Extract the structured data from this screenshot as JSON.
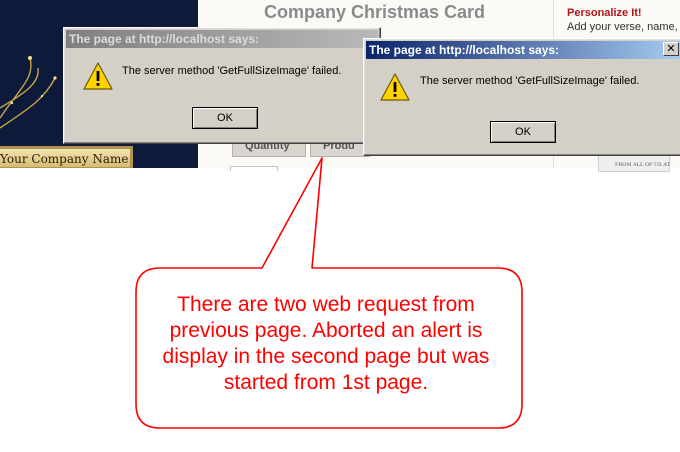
{
  "background_page": {
    "title": "Company Christmas Card",
    "card_nameplate": "Your Company Name",
    "tabs": [
      "Quantity",
      "Produ"
    ],
    "sidebar": {
      "heading": "Personalize It!",
      "text": "Add your verse, name,",
      "preview_text": "FROM ALL OF US AT"
    },
    "select_arrow": "⌄"
  },
  "dialogs": [
    {
      "title": "The page at http://localhost says:",
      "message": "The server method 'GetFullSizeImage' failed.",
      "ok_label": "OK",
      "icon": "warning-icon",
      "state": "inactive"
    },
    {
      "title": "The page at http://localhost says:",
      "message": "The server method 'GetFullSizeImage' failed.",
      "ok_label": "OK",
      "close_label": "✕",
      "icon": "warning-icon",
      "state": "active"
    }
  ],
  "callout": {
    "text": "There are two web request from previous page. Aborted an alert is display in the second page but was started from 1st page.",
    "color": "#ff0000"
  },
  "colors": {
    "active_title": "#0a246a",
    "dialog_face": "#d4d0c8",
    "warning_fill": "#ffd200"
  }
}
